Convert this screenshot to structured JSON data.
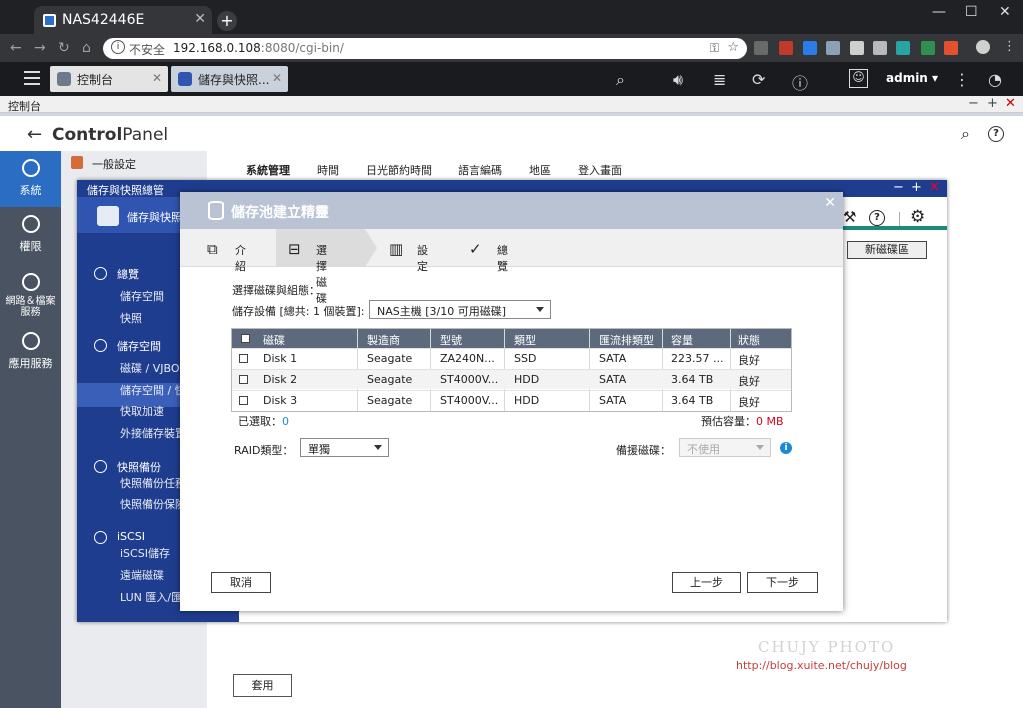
{
  "browser": {
    "tab_title": "NAS42446E",
    "new_tab": "+",
    "security": "不安全",
    "url_host": "192.168.0.108",
    "url_path": ":8080/cgi-bin/",
    "window_controls": [
      "—",
      "☐",
      "✕"
    ],
    "extensions": [
      {
        "name": "ext-1",
        "color": "#6a6a6a"
      },
      {
        "name": "abp",
        "color": "#c0392b"
      },
      {
        "name": "ext-3",
        "color": "#2d7be5"
      },
      {
        "name": "ext-4",
        "color": "#8da1b5"
      },
      {
        "name": "ext-5",
        "color": "#cfcfcf"
      },
      {
        "name": "ext-6",
        "color": "#b9b9b9"
      },
      {
        "name": "ext-7",
        "color": "#2aa3a3"
      },
      {
        "name": "ext-8",
        "color": "#2f8f4f"
      },
      {
        "name": "ext-9",
        "color": "#e4502f"
      }
    ]
  },
  "qts": {
    "tabs": [
      {
        "label": "控制台"
      },
      {
        "label": "儲存與快照..."
      }
    ],
    "user": "admin",
    "icons": [
      "search-icon",
      "volume-icon",
      "stack-icon",
      "sync-icon",
      "info-icon",
      "user-icon",
      "more-icon",
      "gauge-icon"
    ]
  },
  "control_panel": {
    "window_title": "控制台",
    "title_a": "Control",
    "title_b": "Panel",
    "rail": [
      "系統",
      "權限",
      "網路＆檔案服務",
      "應用服務"
    ],
    "subnav_first": "一般設定",
    "tabs": [
      "系統管理",
      "時間",
      "日光節約時間",
      "語言編碼",
      "地區",
      "登入畫面"
    ],
    "apply": "套用"
  },
  "storage_window": {
    "title": "儲存與快照總管",
    "header": "儲存與快照",
    "new_volume": "新磁碟區",
    "groups": [
      {
        "label": "總覽",
        "items": [
          "儲存空間",
          "快照"
        ]
      },
      {
        "label": "儲存空間",
        "items": [
          "磁碟 / VJBOD",
          "儲存空間 / 快",
          "快取加速",
          "外接儲存裝置"
        ]
      },
      {
        "label": "快照備份",
        "items": [
          "快照備份任務",
          "快照備份保險"
        ]
      },
      {
        "label": "iSCSI",
        "items": [
          "iSCSI儲存",
          "遠端磁碟",
          "LUN 匯入/匯出"
        ]
      }
    ]
  },
  "wizard": {
    "title": "儲存池建立精靈",
    "steps": [
      "介紹",
      "選擇磁碟",
      "設定",
      "總覽"
    ],
    "active_step": 1,
    "section_label": "選擇磁碟與組態：",
    "device_label": "儲存設備 [總共: 1 個裝置]:",
    "device_value": "NAS主機 [3/10 可用磁碟]",
    "columns": [
      "磁碟",
      "製造商",
      "型號",
      "類型",
      "匯流排類型",
      "容量",
      "狀態"
    ],
    "disks": [
      {
        "disk": "Disk 1",
        "vendor": "Seagate",
        "model": "ZA240N...",
        "type": "SSD",
        "bus": "SATA",
        "capacity": "223.57 ...",
        "status": "良好"
      },
      {
        "disk": "Disk 2",
        "vendor": "Seagate",
        "model": "ST4000V...",
        "type": "HDD",
        "bus": "SATA",
        "capacity": "3.64 TB",
        "status": "良好"
      },
      {
        "disk": "Disk 3",
        "vendor": "Seagate",
        "model": "ST4000V...",
        "type": "HDD",
        "bus": "SATA",
        "capacity": "3.64 TB",
        "status": "良好"
      }
    ],
    "selected_label": "已選取：",
    "selected_count": "0",
    "est_label": "預估容量：",
    "est_value": "0 MB",
    "raid_label": "RAID類型：",
    "raid_value": "單獨",
    "spare_label": "備援磁碟：",
    "spare_value": "不使用",
    "cancel": "取消",
    "prev": "上一步",
    "next": "下一步"
  },
  "watermark": {
    "line1": "CHUJY PHOTO",
    "line2": "http://blog.xuite.net/chujy/blog"
  },
  "colors": {
    "accent": "#1e3d8f",
    "rail": "#4a5361",
    "wizard_title": "#b9c3d3",
    "table_head": "#5d6a7e",
    "link_value": "#1e88d8",
    "warn_value": "#d0021b"
  }
}
